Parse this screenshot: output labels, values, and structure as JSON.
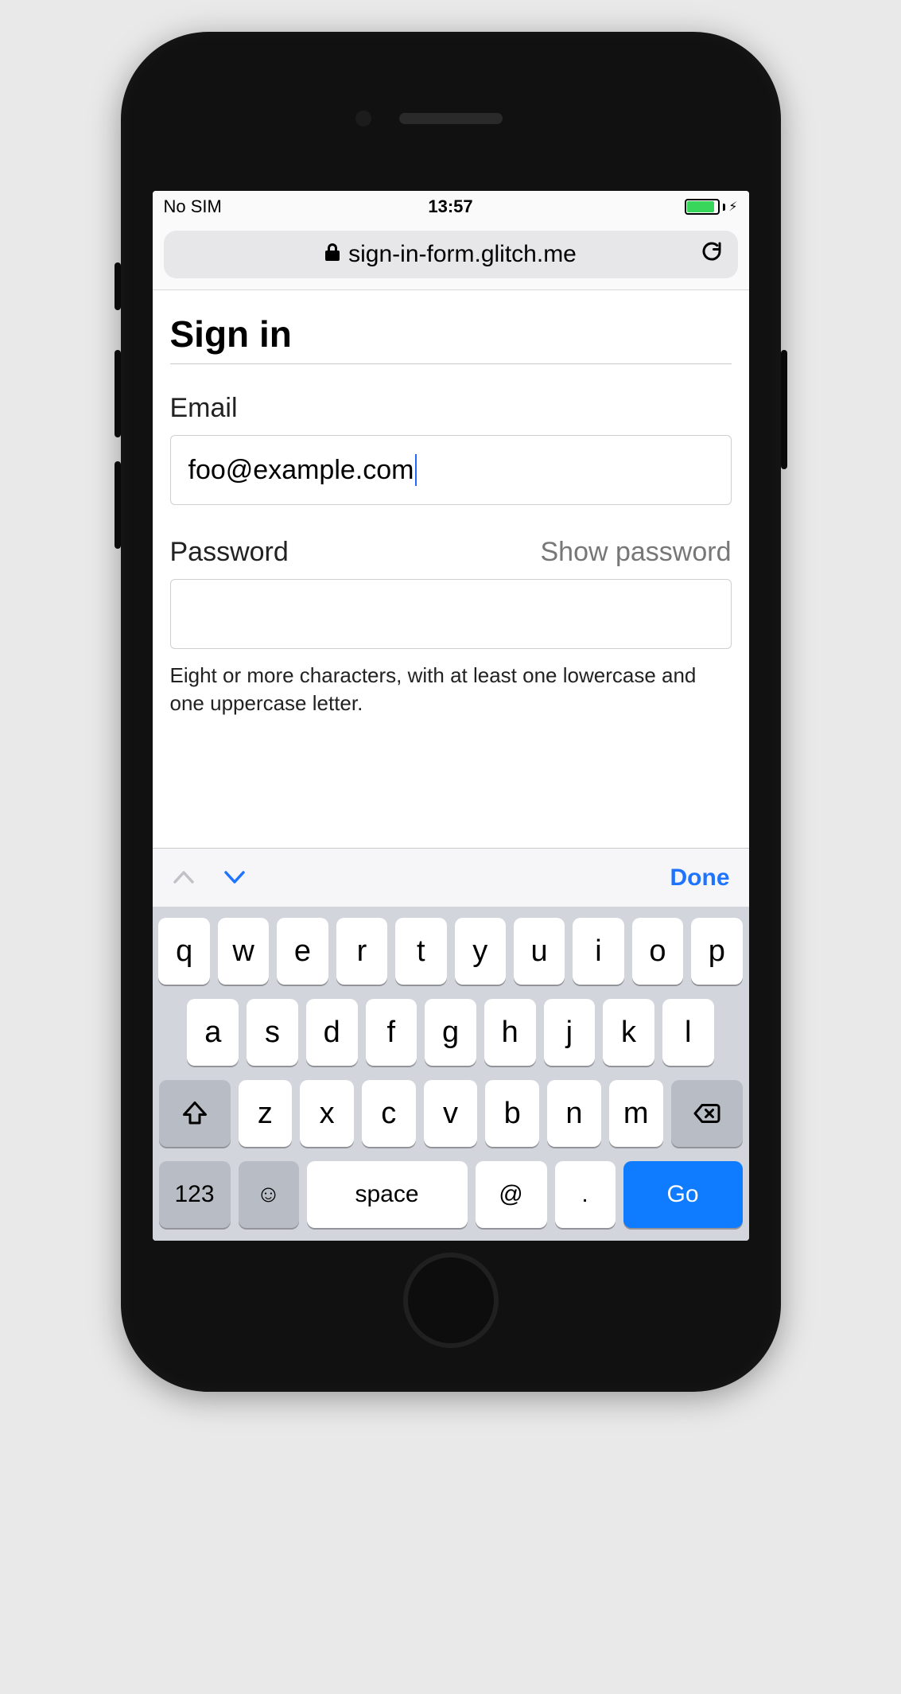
{
  "status": {
    "carrier": "No SIM",
    "time": "13:57"
  },
  "browser": {
    "url_host": "sign-in-form.glitch.me"
  },
  "page": {
    "title": "Sign in",
    "email_label": "Email",
    "email_value": "foo@example.com",
    "password_label": "Password",
    "show_password": "Show password",
    "password_hint": "Eight or more characters, with at least one lowercase and one uppercase letter."
  },
  "kbd_accessory": {
    "done": "Done"
  },
  "keyboard": {
    "row1": [
      "q",
      "w",
      "e",
      "r",
      "t",
      "y",
      "u",
      "i",
      "o",
      "p"
    ],
    "row2": [
      "a",
      "s",
      "d",
      "f",
      "g",
      "h",
      "j",
      "k",
      "l"
    ],
    "row3": [
      "z",
      "x",
      "c",
      "v",
      "b",
      "n",
      "m"
    ],
    "fn": {
      "num": "123",
      "space": "space",
      "at": "@",
      "dot": ".",
      "go": "Go"
    }
  }
}
